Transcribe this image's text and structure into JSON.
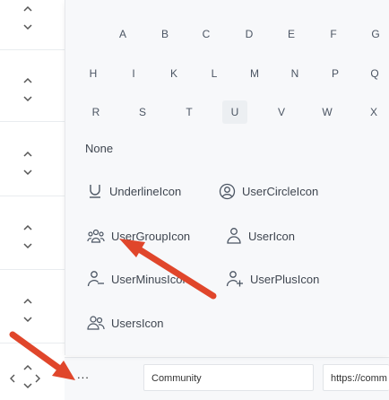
{
  "letters": {
    "row1": [
      "A",
      "B",
      "C",
      "D",
      "E",
      "F",
      "G"
    ],
    "row2": [
      "H",
      "I",
      "K",
      "L",
      "M",
      "N",
      "P",
      "Q"
    ],
    "row3": [
      "R",
      "S",
      "T",
      "U",
      "V",
      "W",
      "X"
    ]
  },
  "selected_letter": "U",
  "none_label": "None",
  "icons": {
    "underline": "UnderlineIcon",
    "user_circle": "UserCircleIcon",
    "user_group": "UserGroupIcon",
    "user": "UserIcon",
    "user_minus": "UserMinusIcon",
    "user_plus": "UserPlusIcon",
    "users": "UsersIcon"
  },
  "row": {
    "ellipsis": "...",
    "name_value": "Community",
    "url_value": "https://comm"
  },
  "colors": {
    "arrow": "#e0462b",
    "panel_bg": "#f7f8fa",
    "text": "#3f4650"
  }
}
